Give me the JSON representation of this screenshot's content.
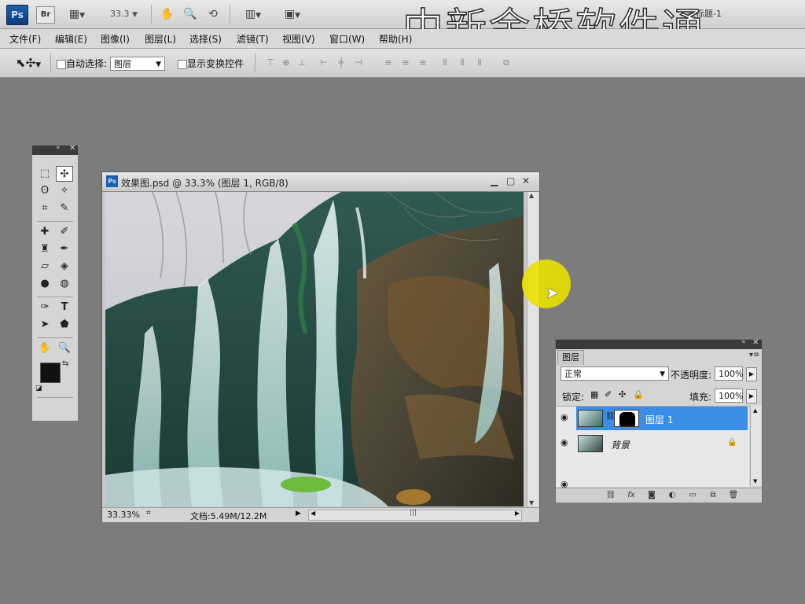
{
  "appbar": {
    "ps_logo": "Ps",
    "br_label": "Br",
    "zoom": "33.3",
    "title_mini": "未标题-1",
    "watermark": "中新金桥软件通"
  },
  "menu": [
    "文件(F)",
    "编辑(E)",
    "图像(I)",
    "图层(L)",
    "选择(S)",
    "滤镜(T)",
    "视图(V)",
    "窗口(W)",
    "帮助(H)"
  ],
  "options": {
    "auto_select_label": "自动选择:",
    "auto_select_value": "图层",
    "show_transform_label": "显示变换控件"
  },
  "document": {
    "title": "效果图.psd @ 33.3% (图层 1, RGB/8)",
    "zoom": "33.33%",
    "doc_info": "文档:5.49M/12.2M"
  },
  "layers_panel": {
    "tab": "图层",
    "blend_mode": "正常",
    "opacity_label": "不透明度:",
    "opacity": "100%",
    "lock_label": "锁定:",
    "fill_label": "填充:",
    "fill": "100%",
    "layers": [
      {
        "name": "图层 1",
        "selected": true
      },
      {
        "name": "背景",
        "selected": false
      }
    ]
  },
  "colors": {
    "workspace": "#7c7c7c",
    "selection": "#3a8ee6",
    "cursor_highlight": "#e9e000"
  }
}
